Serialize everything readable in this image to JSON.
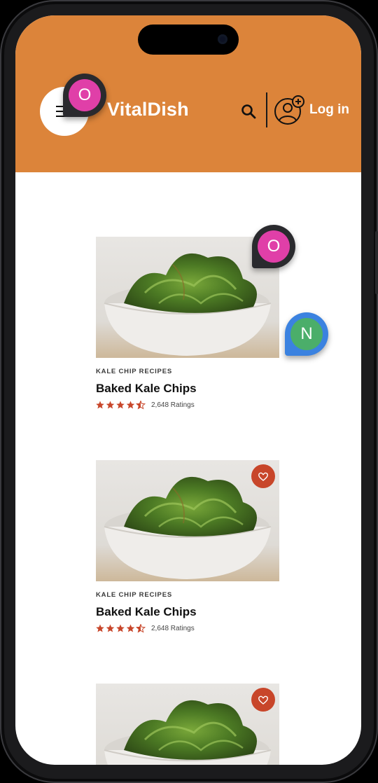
{
  "header": {
    "brand": "VitalDish",
    "login_label": "Log in",
    "icons": [
      "menu-icon",
      "search-icon",
      "user-add-icon"
    ]
  },
  "cards": [
    {
      "category": "KALE CHIP RECIPES",
      "title": "Baked Kale Chips",
      "rating": 4.5,
      "ratings_text": "2,648 Ratings"
    },
    {
      "category": "KALE CHIP RECIPES",
      "title": "Baked Kale Chips",
      "rating": 4.5,
      "ratings_text": "2,648 Ratings"
    },
    {
      "category": "",
      "title": "",
      "rating": null,
      "ratings_text": ""
    }
  ],
  "collaborators": [
    {
      "initial": "O",
      "color": "#E03FA8",
      "ring": "#2a2a2e"
    },
    {
      "initial": "O",
      "color": "#E03FA8",
      "ring": "#2a2a2e"
    },
    {
      "initial": "N",
      "color": "#4BAE6A",
      "ring": "#3B82E0"
    }
  ],
  "colors": {
    "header_bg": "#DC843A",
    "accent": "#C8462A",
    "star": "#C8462A"
  }
}
